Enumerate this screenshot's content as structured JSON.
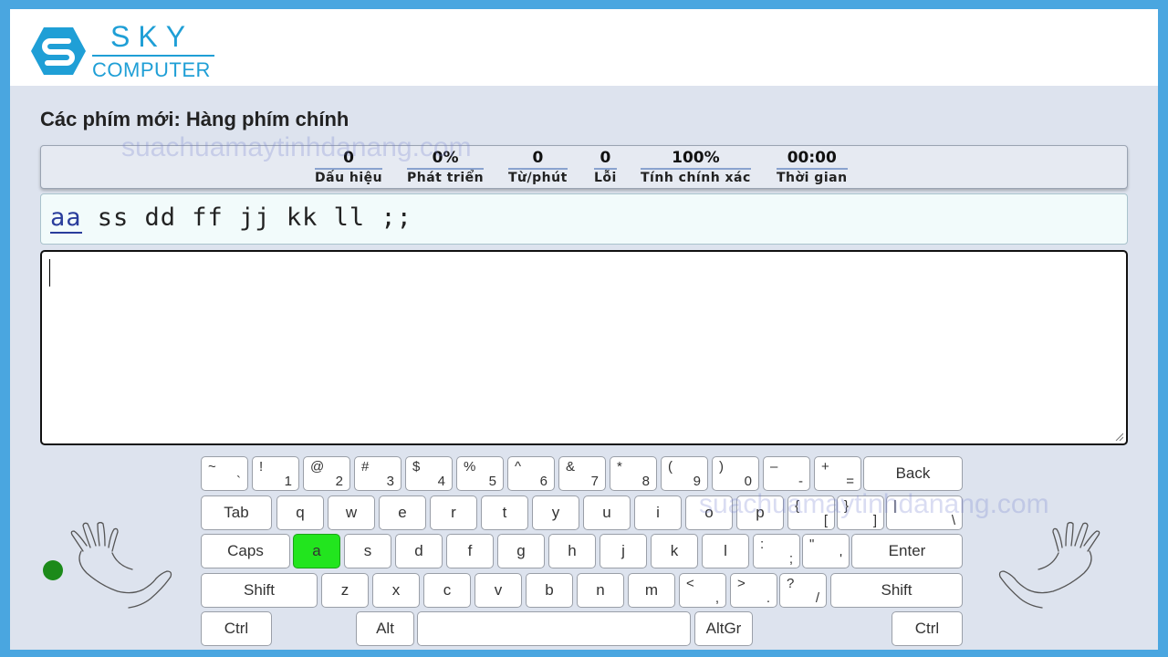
{
  "brand": {
    "line1": "SKY",
    "line2": "COMPUTER"
  },
  "page": {
    "title": "Các phím mới: Hàng phím chính"
  },
  "watermark": "suachuamaytinhdanang.com",
  "stats": [
    {
      "value": "0",
      "label": "Dấu hiệu"
    },
    {
      "value": "0%",
      "label": "Phát triển"
    },
    {
      "value": "0",
      "label": "Từ/phút"
    },
    {
      "value": "0",
      "label": "Lỗi"
    },
    {
      "value": "100%",
      "label": "Tính chính xác"
    },
    {
      "value": "00:00",
      "label": "Thời gian"
    }
  ],
  "lesson": {
    "current": "aa",
    "rest": " ss dd ff jj kk ll ;;"
  },
  "typing_area": {
    "value": ""
  },
  "keyboard": {
    "active_key": "a",
    "rows": [
      [
        {
          "top": "~",
          "bot": "`"
        },
        {
          "top": "!",
          "bot": "1"
        },
        {
          "top": "@",
          "bot": "2"
        },
        {
          "top": "#",
          "bot": "3"
        },
        {
          "top": "$",
          "bot": "4"
        },
        {
          "top": "%",
          "bot": "5"
        },
        {
          "top": "^",
          "bot": "6"
        },
        {
          "top": "&",
          "bot": "7"
        },
        {
          "top": "*",
          "bot": "8"
        },
        {
          "top": "(",
          "bot": "9"
        },
        {
          "top": ")",
          "bot": "0"
        },
        {
          "top": "–",
          "bot": "-"
        },
        {
          "top": "+",
          "bot": "="
        },
        {
          "main": "Back"
        }
      ],
      [
        {
          "main": "Tab"
        },
        {
          "main": "q"
        },
        {
          "main": "w"
        },
        {
          "main": "e"
        },
        {
          "main": "r"
        },
        {
          "main": "t"
        },
        {
          "main": "y"
        },
        {
          "main": "u"
        },
        {
          "main": "i"
        },
        {
          "main": "o"
        },
        {
          "main": "p"
        },
        {
          "top": "{",
          "bot": "["
        },
        {
          "top": "}",
          "bot": "]"
        },
        {
          "top": "|",
          "bot": "\\"
        }
      ],
      [
        {
          "main": "Caps"
        },
        {
          "main": "a"
        },
        {
          "main": "s"
        },
        {
          "main": "d"
        },
        {
          "main": "f"
        },
        {
          "main": "g"
        },
        {
          "main": "h"
        },
        {
          "main": "j"
        },
        {
          "main": "k"
        },
        {
          "main": "l"
        },
        {
          "top": ":",
          "bot": ";"
        },
        {
          "top": "\"",
          "bot": "'"
        },
        {
          "main": "Enter"
        }
      ],
      [
        {
          "main": "Shift"
        },
        {
          "main": "z"
        },
        {
          "main": "x"
        },
        {
          "main": "c"
        },
        {
          "main": "v"
        },
        {
          "main": "b"
        },
        {
          "main": "n"
        },
        {
          "main": "m"
        },
        {
          "top": "<",
          "bot": ","
        },
        {
          "top": ">",
          "bot": "."
        },
        {
          "top": "?",
          "bot": "/"
        },
        {
          "main": "Shift"
        }
      ],
      [
        {
          "main": "Ctrl"
        },
        {
          "main": "Alt"
        },
        {
          "main": ""
        },
        {
          "main": "AltGr"
        },
        {
          "main": "Ctrl"
        }
      ]
    ]
  },
  "colors": {
    "active_key": "#22e51e",
    "accent": "#1f9fd6",
    "finger_dot": "#1c8a1a"
  }
}
